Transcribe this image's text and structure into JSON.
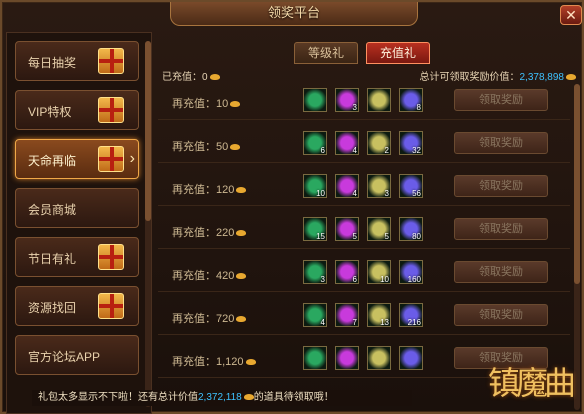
{
  "window": {
    "title": "领奖平台",
    "close_label": "✕"
  },
  "sidebar": {
    "items": [
      {
        "label": "每日抽奖",
        "has_gift": true
      },
      {
        "label": "VIP特权",
        "has_gift": true
      },
      {
        "label": "天命再临",
        "has_gift": true,
        "active": true,
        "arrow": "›"
      },
      {
        "label": "会员商城",
        "has_gift": false
      },
      {
        "label": "节日有礼",
        "has_gift": true
      },
      {
        "label": "资源找回",
        "has_gift": true
      },
      {
        "label": "官方论坛APP",
        "has_gift": false
      }
    ]
  },
  "tabs": [
    {
      "label": "等级礼",
      "active": false
    },
    {
      "label": "充值礼",
      "active": true
    }
  ],
  "summary": {
    "charged_label": "已充值：0",
    "total_label": "总计可领取奖励价值：",
    "total_value": "2,378,898"
  },
  "rows": [
    {
      "label": "再充值：10",
      "counts": [
        "",
        "3",
        "",
        "8"
      ],
      "claim": "领取奖励"
    },
    {
      "label": "再充值：50",
      "counts": [
        "6",
        "4",
        "2",
        "32"
      ],
      "claim": "领取奖励"
    },
    {
      "label": "再充值：120",
      "counts": [
        "10",
        "4",
        "3",
        "56"
      ],
      "claim": "领取奖励"
    },
    {
      "label": "再充值：220",
      "counts": [
        "15",
        "5",
        "5",
        "80"
      ],
      "claim": "领取奖励"
    },
    {
      "label": "再充值：420",
      "counts": [
        "3",
        "6",
        "10",
        "160"
      ],
      "claim": "领取奖励"
    },
    {
      "label": "再充值：720",
      "counts": [
        "4",
        "7",
        "13",
        "216"
      ],
      "claim": "领取奖励"
    },
    {
      "label": "再充值：1,120",
      "counts": [
        "",
        "",
        "",
        ""
      ],
      "claim": "领取奖励"
    }
  ],
  "footer": {
    "prefix": "礼包太多显示不下啦！还有总计价值",
    "value": "2,372,118",
    "suffix": "的道具待领取哦！"
  },
  "logo_text": "镇魔曲",
  "item_colors": [
    "#2aa860",
    "#c83adc",
    "#c8c060",
    "#6a5ce8"
  ]
}
